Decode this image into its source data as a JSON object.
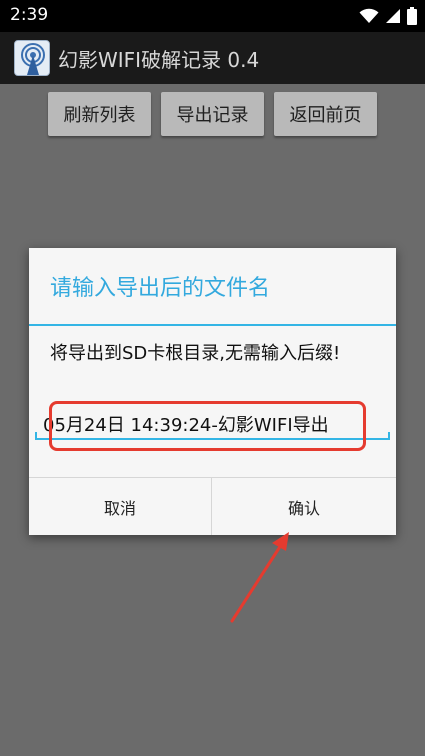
{
  "status_bar": {
    "time": "2:39",
    "icons": [
      "wifi-icon",
      "cellular-signal-icon",
      "battery-icon"
    ]
  },
  "action_bar": {
    "title": "幻影WIFI破解记录 0.4",
    "icon": "wifi-tower-app-icon"
  },
  "toolbar": {
    "refresh_label": "刷新列表",
    "export_label": "导出记录",
    "back_label": "返回前页"
  },
  "dialog": {
    "title": "请输入导出后的文件名",
    "message": "将导出到SD卡根目录,无需输入后缀!",
    "filename_value": "05月24日 14:39:24-幻影WIFI导出",
    "cancel_label": "取消",
    "confirm_label": "确认"
  },
  "colors": {
    "accent": "#33b5e5",
    "annotation": "#e53b2f",
    "overlay": "#6b6b6b"
  }
}
